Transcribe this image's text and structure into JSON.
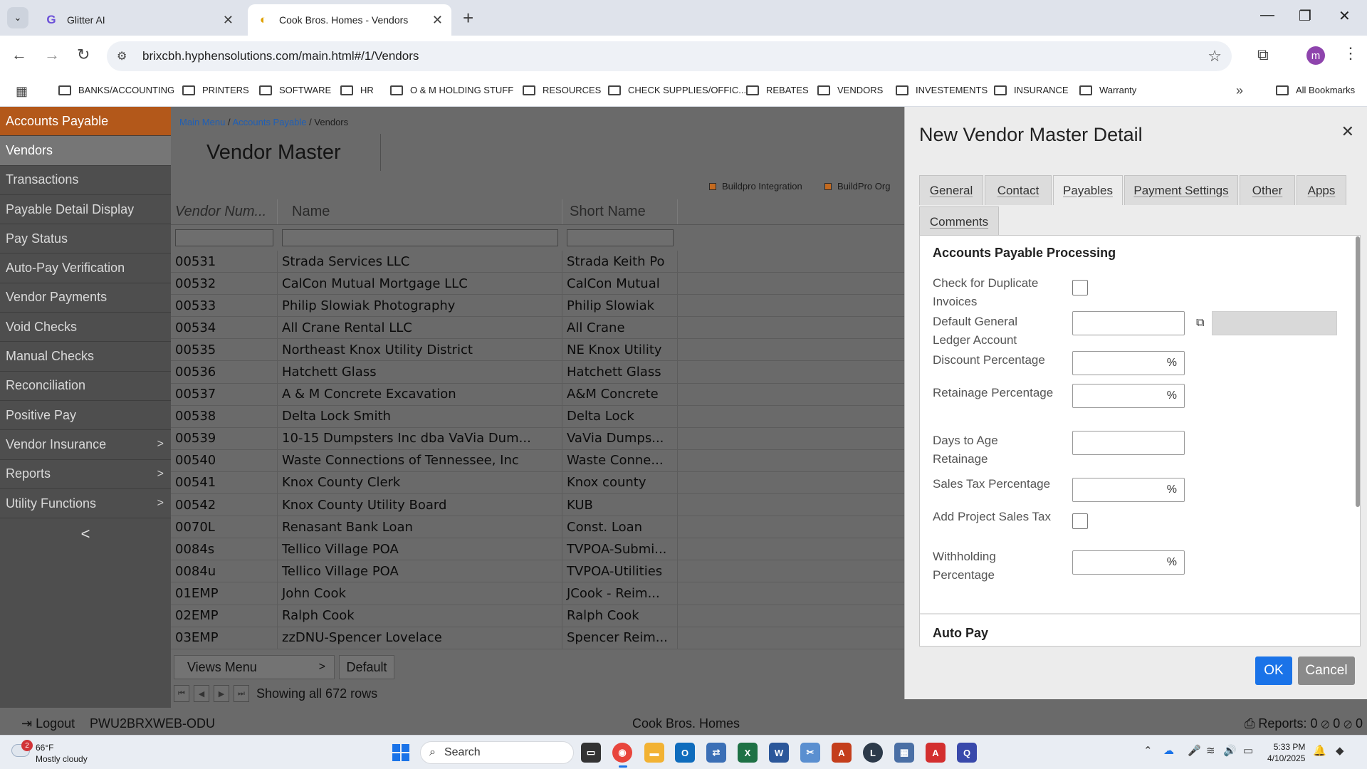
{
  "browser": {
    "tabs": [
      {
        "title": "Glitter AI",
        "favicon": "G"
      },
      {
        "title": "Cook Bros. Homes - Vendors",
        "favicon": "◐"
      }
    ],
    "url": "brixcbh.hyphensolutions.com/main.html#/1/Vendors",
    "profile_initial": "m",
    "bookmarks": [
      "BANKS/ACCOUNTING",
      "PRINTERS",
      "SOFTWARE",
      "HR",
      "O & M HOLDING STUFF",
      "RESOURCES",
      "CHECK SUPPLIES/OFFIC...",
      "REBATES",
      "VENDORS",
      "INVESTEMENTS",
      "INSURANCE",
      "Warranty"
    ],
    "all_bookmarks": "All Bookmarks"
  },
  "sidebar": {
    "header": "Accounts Payable",
    "items": [
      {
        "label": "Vendors",
        "selected": true,
        "submenu": false
      },
      {
        "label": "Transactions",
        "submenu": false
      },
      {
        "label": "Payable Detail Display",
        "submenu": false
      },
      {
        "label": "Pay Status",
        "submenu": false
      },
      {
        "label": "Auto-Pay Verification",
        "submenu": false
      },
      {
        "label": "Vendor Payments",
        "submenu": false
      },
      {
        "label": "Void Checks",
        "submenu": false
      },
      {
        "label": "Manual Checks",
        "submenu": false
      },
      {
        "label": "Reconciliation",
        "submenu": false
      },
      {
        "label": "Positive Pay",
        "submenu": false
      },
      {
        "label": "Vendor Insurance",
        "submenu": true
      },
      {
        "label": "Reports",
        "submenu": true
      },
      {
        "label": "Utility Functions",
        "submenu": true
      }
    ],
    "collapse": "<"
  },
  "main": {
    "breadcrumb": {
      "root": "Main Menu",
      "mid": "Accounts Payable",
      "current": "Vendors",
      "sep": "/"
    },
    "title": "Vendor Master",
    "legend": [
      "Buildpro Integration",
      "BuildPro Org"
    ],
    "columns": [
      "Vendor Num...",
      "Name",
      "Short Name"
    ],
    "rows": [
      {
        "num": "00531",
        "name": "Strada Services LLC",
        "short": "Strada Keith Po"
      },
      {
        "num": "00532",
        "name": "CalCon Mutual Mortgage LLC",
        "short": "CalCon Mutual"
      },
      {
        "num": "00533",
        "name": "Philip Slowiak Photography",
        "short": "Philip Slowiak"
      },
      {
        "num": "00534",
        "name": "All Crane Rental LLC",
        "short": "All Crane"
      },
      {
        "num": "00535",
        "name": "Northeast Knox Utility District",
        "short": "NE Knox Utility"
      },
      {
        "num": "00536",
        "name": "Hatchett Glass",
        "short": "Hatchett Glass"
      },
      {
        "num": "00537",
        "name": "A & M Concrete Excavation",
        "short": "A&M Concrete"
      },
      {
        "num": "00538",
        "name": "Delta Lock Smith",
        "short": "Delta Lock"
      },
      {
        "num": "00539",
        "name": "10-15 Dumpsters Inc dba VaVia Dum...",
        "short": "VaVia Dumps..."
      },
      {
        "num": "00540",
        "name": "Waste Connections of Tennessee, Inc",
        "short": "Waste Conne..."
      },
      {
        "num": "00541",
        "name": "Knox County Clerk",
        "short": "Knox county"
      },
      {
        "num": "00542",
        "name": "Knox County Utility Board",
        "short": "KUB"
      },
      {
        "num": "0070L",
        "name": "Renasant Bank Loan",
        "short": "Const. Loan"
      },
      {
        "num": "0084s",
        "name": "Tellico Village POA",
        "short": "TVPOA-Submi..."
      },
      {
        "num": "0084u",
        "name": "Tellico Village POA",
        "short": "TVPOA-Utilities"
      },
      {
        "num": "01EMP",
        "name": "John Cook",
        "short": "JCook - Reim..."
      },
      {
        "num": "02EMP",
        "name": "Ralph Cook",
        "short": "Ralph Cook"
      },
      {
        "num": "03EMP",
        "name": "zzDNU-Spencer Lovelace",
        "short": "Spencer Reim..."
      }
    ],
    "views_menu": "Views Menu",
    "default_view": "Default",
    "rows_status": "Showing all 672 rows"
  },
  "status_bar": {
    "logout": "Logout",
    "machine": "PWU2BRXWEB-ODU",
    "company": "Cook Bros. Homes",
    "reports": "Reports: 0",
    "reports_extra": "0",
    "reports_extra2": "0"
  },
  "modal": {
    "title": "New Vendor Master Detail",
    "tabs": [
      "General",
      "Contact",
      "Payables",
      "Payment Settings",
      "Other",
      "Apps",
      "Comments"
    ],
    "active_tab": "Payables",
    "section1": "Accounts Payable Processing",
    "fields": {
      "dup_check": "Check for Duplicate Invoices",
      "gl_account": "Default General Ledger Account",
      "discount": "Discount Percentage",
      "retainage": "Retainage Percentage",
      "days_retainage": "Days to Age Retainage",
      "sales_tax": "Sales Tax Percentage",
      "project_tax": "Add Project Sales Tax",
      "withholding": "Withholding Percentage"
    },
    "percent": "%",
    "section2": "Auto Pay",
    "ok": "OK",
    "cancel": "Cancel"
  },
  "taskbar": {
    "weather_temp": "66°F",
    "weather_desc": "Mostly cloudy",
    "weather_badge": "2",
    "search": "Search",
    "time": "5:33 PM",
    "date": "4/10/2025"
  }
}
